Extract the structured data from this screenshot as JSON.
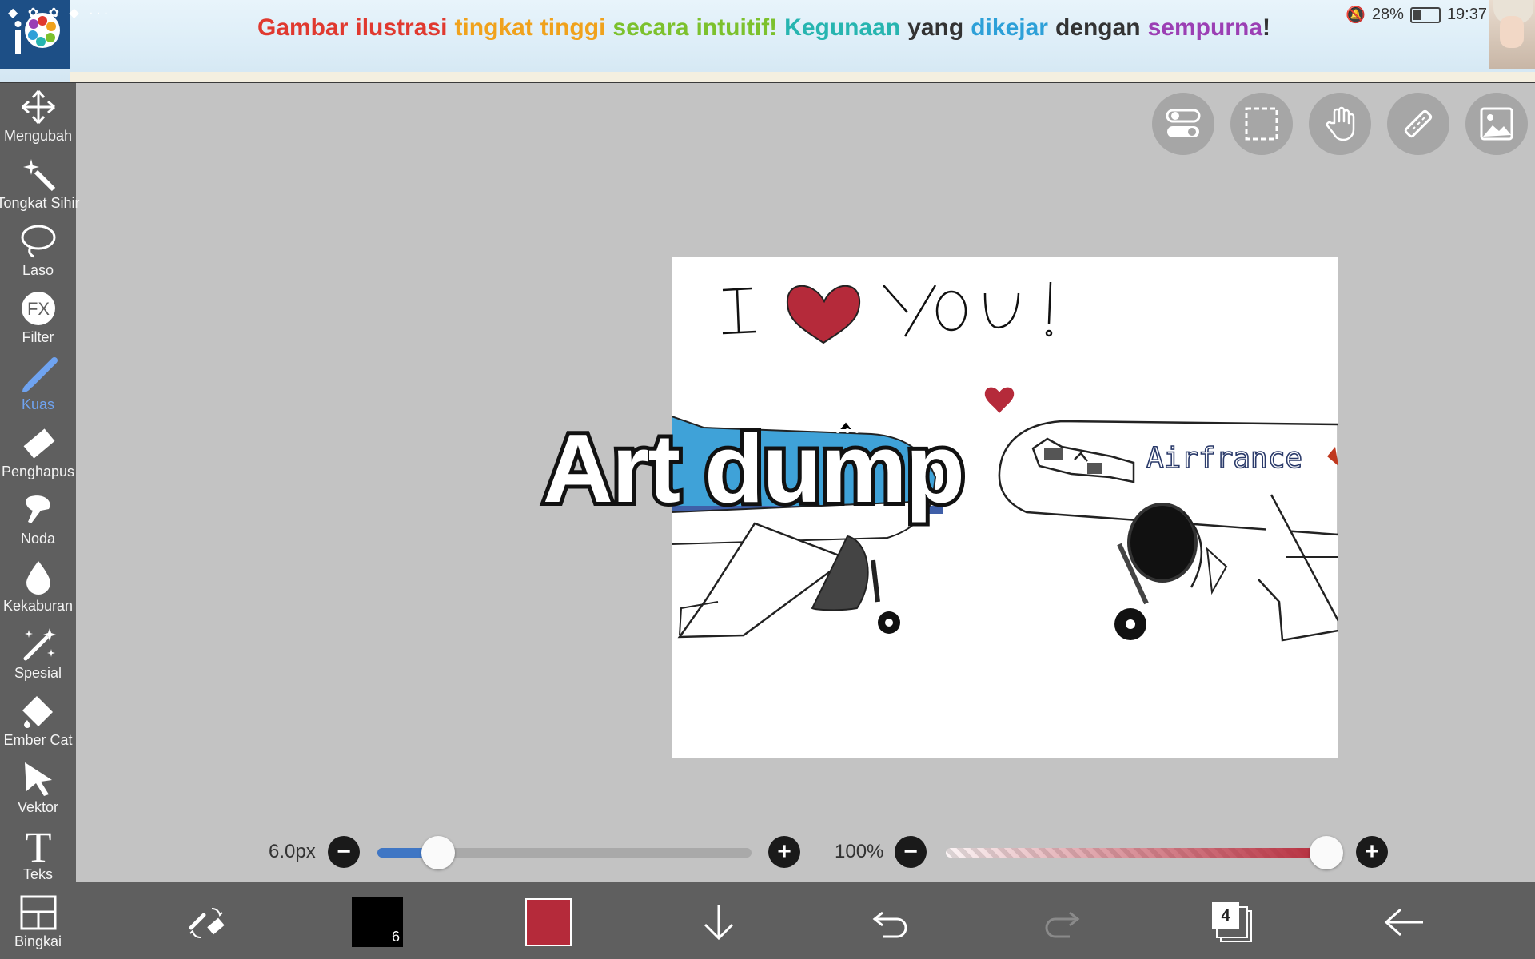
{
  "banner": {
    "segments": [
      {
        "text": "Gambar",
        "color": "#e0392f"
      },
      {
        "text": "ilustrasi",
        "color": "#e0392f"
      },
      {
        "text": "tingkat",
        "color": "#f0a21c"
      },
      {
        "text": "tinggi",
        "color": "#f0a21c"
      },
      {
        "text": "secara",
        "color": "#7cc12d"
      },
      {
        "text": "intuitif!",
        "color": "#7cc12d"
      },
      {
        "text": "Kegunaan",
        "color": "#27b5b0"
      },
      {
        "text": "yang",
        "color": "#333333"
      },
      {
        "text": "dikejar",
        "color": "#2da0d8"
      },
      {
        "text": "dengan",
        "color": "#333333"
      },
      {
        "text": "sempurna",
        "color": "#9b3fb4"
      },
      {
        "text": "!",
        "color": "#333333"
      }
    ]
  },
  "status": {
    "battery": "28%",
    "time": "19:37",
    "icons": "◆ ✿ ✿ ◆ ···"
  },
  "tools": [
    {
      "label": "Mengubah",
      "icon": "move-icon"
    },
    {
      "label": "Tongkat Sihir",
      "icon": "magic-wand-icon"
    },
    {
      "label": "Laso",
      "icon": "lasso-icon"
    },
    {
      "label": "Filter",
      "icon": "fx-icon",
      "glyph": "FX"
    },
    {
      "label": "Kuas",
      "icon": "brush-icon",
      "active": true
    },
    {
      "label": "Penghapus",
      "icon": "eraser-icon"
    },
    {
      "label": "Noda",
      "icon": "smudge-icon"
    },
    {
      "label": "Kekaburan",
      "icon": "blur-drop-icon"
    },
    {
      "label": "Spesial",
      "icon": "special-icon"
    },
    {
      "label": "Ember Cat",
      "icon": "paint-bucket-icon"
    },
    {
      "label": "Vektor",
      "icon": "vector-arrow-icon"
    },
    {
      "label": "Teks",
      "icon": "text-icon",
      "glyph": "T"
    },
    {
      "label": "Bingkai",
      "icon": "frame-icon"
    }
  ],
  "canvas": {
    "drawing_text": "I ♥ YOU!",
    "plane_label": "Airfrance",
    "overlay_title": "Art dump"
  },
  "brush": {
    "size_label": "6.0px",
    "size_fraction": 0.14
  },
  "opacity": {
    "label": "100%",
    "fraction": 1.0
  },
  "bottom": {
    "layers_count": "4",
    "brush_size_badge": "6"
  },
  "colors": {
    "primary": "#b52a3a",
    "secondary": "#000000",
    "accent_blue": "#3f76c4"
  }
}
